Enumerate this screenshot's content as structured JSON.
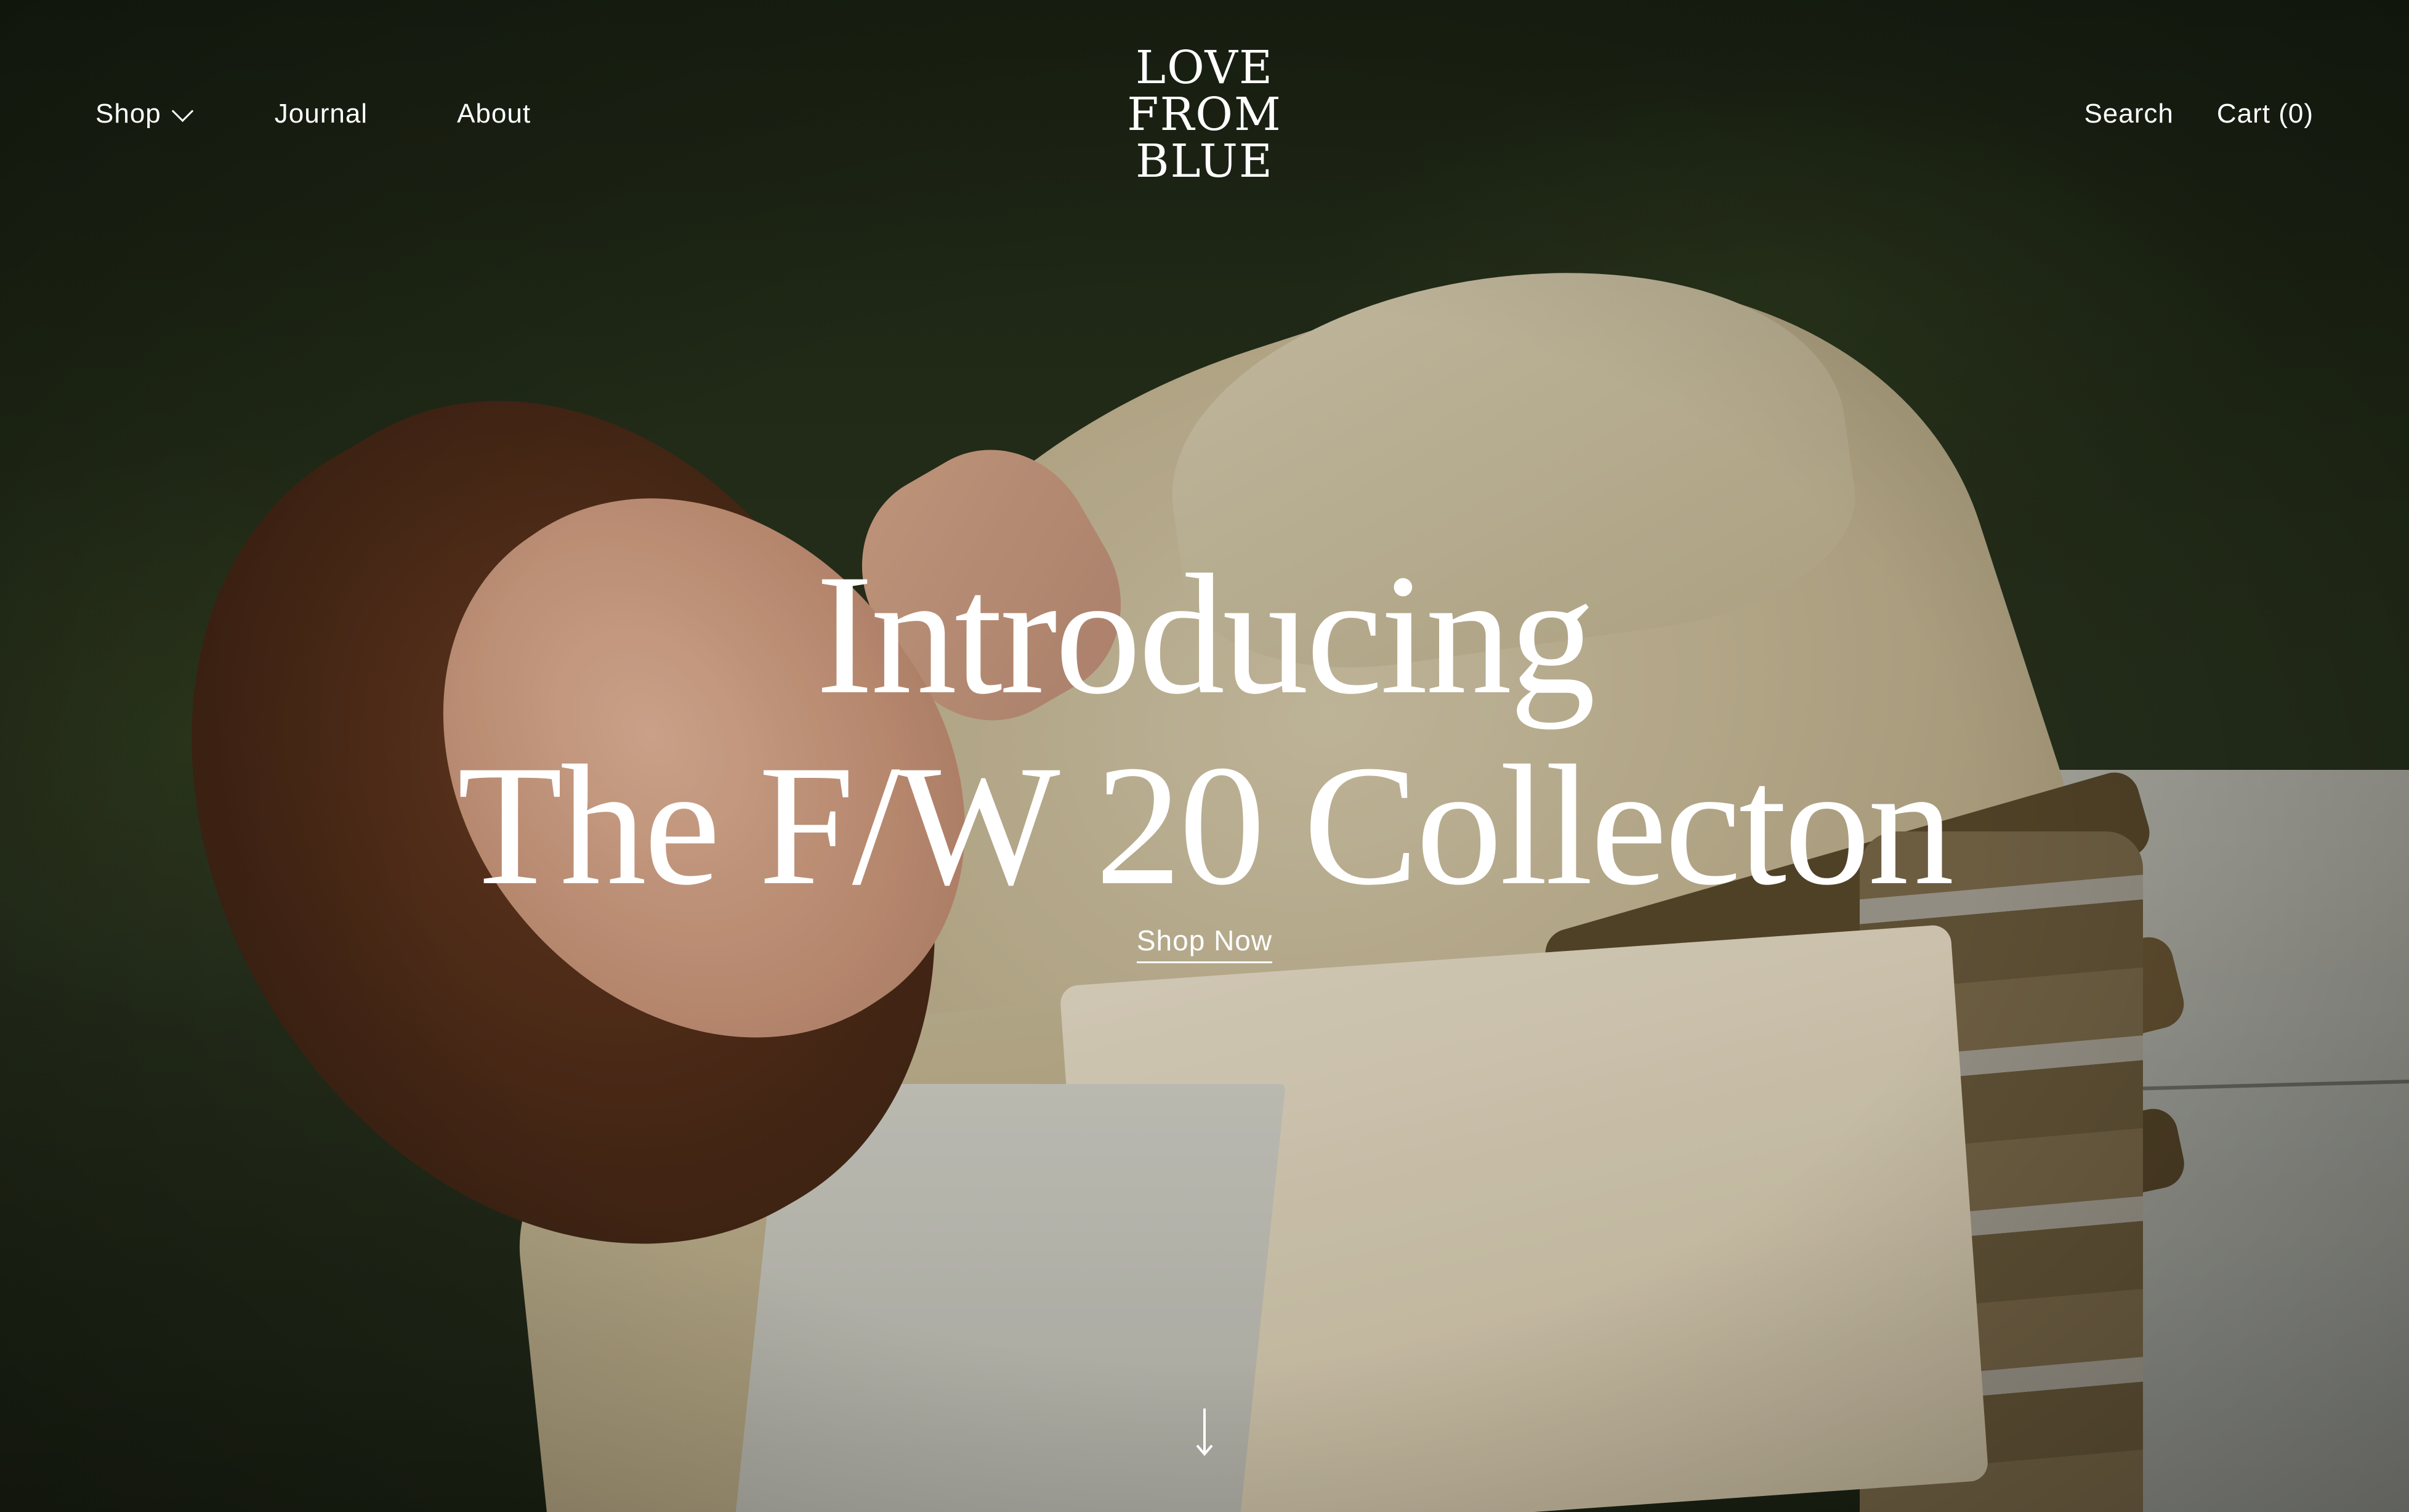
{
  "brand": {
    "logo_lines": [
      "LOVE",
      "FROM",
      "BLUE"
    ]
  },
  "nav": {
    "left": [
      {
        "label": "Shop",
        "has_dropdown": true,
        "icon": "chevron-down-icon"
      },
      {
        "label": "Journal"
      },
      {
        "label": "About"
      }
    ],
    "right": {
      "search_label": "Search",
      "cart_label": "Cart (0)"
    }
  },
  "hero": {
    "headline_line1": "Introducing",
    "headline_line2": "The F/W 20 Collecton",
    "cta_label": "Shop Now",
    "scroll_icon": "arrow-down-icon"
  },
  "colors": {
    "text": "#ffffff"
  }
}
